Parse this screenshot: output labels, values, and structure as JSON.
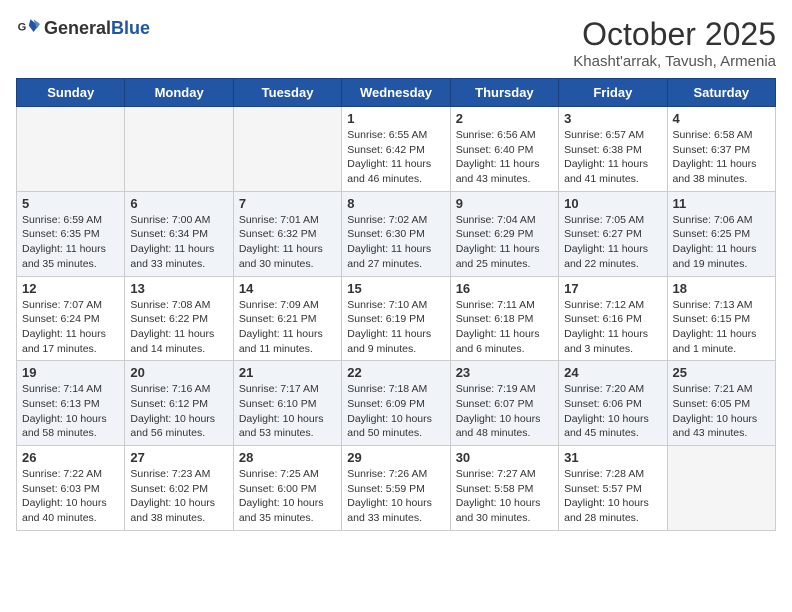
{
  "header": {
    "logo_general": "General",
    "logo_blue": "Blue",
    "title": "October 2025",
    "subtitle": "Khasht'arrak, Tavush, Armenia"
  },
  "weekdays": [
    "Sunday",
    "Monday",
    "Tuesday",
    "Wednesday",
    "Thursday",
    "Friday",
    "Saturday"
  ],
  "weeks": [
    {
      "days": [
        {
          "num": "",
          "info": "",
          "empty": true
        },
        {
          "num": "",
          "info": "",
          "empty": true
        },
        {
          "num": "",
          "info": "",
          "empty": true
        },
        {
          "num": "1",
          "info": "Sunrise: 6:55 AM\nSunset: 6:42 PM\nDaylight: 11 hours\nand 46 minutes.",
          "empty": false
        },
        {
          "num": "2",
          "info": "Sunrise: 6:56 AM\nSunset: 6:40 PM\nDaylight: 11 hours\nand 43 minutes.",
          "empty": false
        },
        {
          "num": "3",
          "info": "Sunrise: 6:57 AM\nSunset: 6:38 PM\nDaylight: 11 hours\nand 41 minutes.",
          "empty": false
        },
        {
          "num": "4",
          "info": "Sunrise: 6:58 AM\nSunset: 6:37 PM\nDaylight: 11 hours\nand 38 minutes.",
          "empty": false
        }
      ]
    },
    {
      "days": [
        {
          "num": "5",
          "info": "Sunrise: 6:59 AM\nSunset: 6:35 PM\nDaylight: 11 hours\nand 35 minutes.",
          "empty": false
        },
        {
          "num": "6",
          "info": "Sunrise: 7:00 AM\nSunset: 6:34 PM\nDaylight: 11 hours\nand 33 minutes.",
          "empty": false
        },
        {
          "num": "7",
          "info": "Sunrise: 7:01 AM\nSunset: 6:32 PM\nDaylight: 11 hours\nand 30 minutes.",
          "empty": false
        },
        {
          "num": "8",
          "info": "Sunrise: 7:02 AM\nSunset: 6:30 PM\nDaylight: 11 hours\nand 27 minutes.",
          "empty": false
        },
        {
          "num": "9",
          "info": "Sunrise: 7:04 AM\nSunset: 6:29 PM\nDaylight: 11 hours\nand 25 minutes.",
          "empty": false
        },
        {
          "num": "10",
          "info": "Sunrise: 7:05 AM\nSunset: 6:27 PM\nDaylight: 11 hours\nand 22 minutes.",
          "empty": false
        },
        {
          "num": "11",
          "info": "Sunrise: 7:06 AM\nSunset: 6:25 PM\nDaylight: 11 hours\nand 19 minutes.",
          "empty": false
        }
      ]
    },
    {
      "days": [
        {
          "num": "12",
          "info": "Sunrise: 7:07 AM\nSunset: 6:24 PM\nDaylight: 11 hours\nand 17 minutes.",
          "empty": false
        },
        {
          "num": "13",
          "info": "Sunrise: 7:08 AM\nSunset: 6:22 PM\nDaylight: 11 hours\nand 14 minutes.",
          "empty": false
        },
        {
          "num": "14",
          "info": "Sunrise: 7:09 AM\nSunset: 6:21 PM\nDaylight: 11 hours\nand 11 minutes.",
          "empty": false
        },
        {
          "num": "15",
          "info": "Sunrise: 7:10 AM\nSunset: 6:19 PM\nDaylight: 11 hours\nand 9 minutes.",
          "empty": false
        },
        {
          "num": "16",
          "info": "Sunrise: 7:11 AM\nSunset: 6:18 PM\nDaylight: 11 hours\nand 6 minutes.",
          "empty": false
        },
        {
          "num": "17",
          "info": "Sunrise: 7:12 AM\nSunset: 6:16 PM\nDaylight: 11 hours\nand 3 minutes.",
          "empty": false
        },
        {
          "num": "18",
          "info": "Sunrise: 7:13 AM\nSunset: 6:15 PM\nDaylight: 11 hours\nand 1 minute.",
          "empty": false
        }
      ]
    },
    {
      "days": [
        {
          "num": "19",
          "info": "Sunrise: 7:14 AM\nSunset: 6:13 PM\nDaylight: 10 hours\nand 58 minutes.",
          "empty": false
        },
        {
          "num": "20",
          "info": "Sunrise: 7:16 AM\nSunset: 6:12 PM\nDaylight: 10 hours\nand 56 minutes.",
          "empty": false
        },
        {
          "num": "21",
          "info": "Sunrise: 7:17 AM\nSunset: 6:10 PM\nDaylight: 10 hours\nand 53 minutes.",
          "empty": false
        },
        {
          "num": "22",
          "info": "Sunrise: 7:18 AM\nSunset: 6:09 PM\nDaylight: 10 hours\nand 50 minutes.",
          "empty": false
        },
        {
          "num": "23",
          "info": "Sunrise: 7:19 AM\nSunset: 6:07 PM\nDaylight: 10 hours\nand 48 minutes.",
          "empty": false
        },
        {
          "num": "24",
          "info": "Sunrise: 7:20 AM\nSunset: 6:06 PM\nDaylight: 10 hours\nand 45 minutes.",
          "empty": false
        },
        {
          "num": "25",
          "info": "Sunrise: 7:21 AM\nSunset: 6:05 PM\nDaylight: 10 hours\nand 43 minutes.",
          "empty": false
        }
      ]
    },
    {
      "days": [
        {
          "num": "26",
          "info": "Sunrise: 7:22 AM\nSunset: 6:03 PM\nDaylight: 10 hours\nand 40 minutes.",
          "empty": false
        },
        {
          "num": "27",
          "info": "Sunrise: 7:23 AM\nSunset: 6:02 PM\nDaylight: 10 hours\nand 38 minutes.",
          "empty": false
        },
        {
          "num": "28",
          "info": "Sunrise: 7:25 AM\nSunset: 6:00 PM\nDaylight: 10 hours\nand 35 minutes.",
          "empty": false
        },
        {
          "num": "29",
          "info": "Sunrise: 7:26 AM\nSunset: 5:59 PM\nDaylight: 10 hours\nand 33 minutes.",
          "empty": false
        },
        {
          "num": "30",
          "info": "Sunrise: 7:27 AM\nSunset: 5:58 PM\nDaylight: 10 hours\nand 30 minutes.",
          "empty": false
        },
        {
          "num": "31",
          "info": "Sunrise: 7:28 AM\nSunset: 5:57 PM\nDaylight: 10 hours\nand 28 minutes.",
          "empty": false
        },
        {
          "num": "",
          "info": "",
          "empty": true
        }
      ]
    }
  ]
}
